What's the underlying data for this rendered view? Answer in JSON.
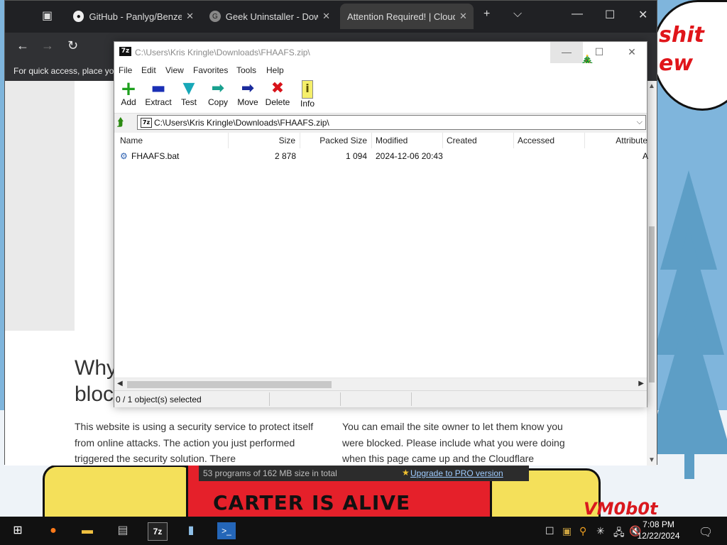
{
  "browser": {
    "tabs": [
      {
        "label": "GitHub - Panlyg/Benzene",
        "close": "✕"
      },
      {
        "label": "Geek Uninstaller - Downl",
        "close": "✕"
      },
      {
        "label": "Attention Required! | Cloudfl",
        "close": "✕"
      }
    ],
    "new_tab": "+",
    "favorites_hint": "For quick access, place you",
    "page": {
      "heading_line1": "Why",
      "heading_line2": "bloc",
      "para_left": "This website is using a security service to protect itself from online attacks. The action you just performed triggered the security solution. There",
      "para_right": "You can email the site owner to let them know you were blocked. Please include what you were doing when this page came up and the Cloudflare"
    }
  },
  "zip": {
    "title": "C:\\Users\\Kris Kringle\\Downloads\\FHAAFS.zip\\",
    "logo": "7z",
    "menu": [
      "File",
      "Edit",
      "View",
      "Favorites",
      "Tools",
      "Help"
    ],
    "toolbar": [
      {
        "label": "Add",
        "icon": "+",
        "color": "#1ea01e"
      },
      {
        "label": "Extract",
        "icon": "▬",
        "color": "#1a2fb5"
      },
      {
        "label": "Test",
        "icon": "▼",
        "color": "#18a8b8"
      },
      {
        "label": "Copy",
        "icon": "➡",
        "color": "#19a08e"
      },
      {
        "label": "Move",
        "icon": "➡",
        "color": "#1a2a9c"
      },
      {
        "label": "Delete",
        "icon": "✖",
        "color": "#d8131a"
      },
      {
        "label": "Info",
        "icon": "i",
        "color": "#5a5000"
      }
    ],
    "path": "C:\\Users\\Kris Kringle\\Downloads\\FHAAFS.zip\\",
    "columns": [
      "Name",
      "Size",
      "Packed Size",
      "Modified",
      "Created",
      "Accessed",
      "Attribute"
    ],
    "rows": [
      {
        "name": "FHAAFS.bat",
        "size": "2 878",
        "packed": "1 094",
        "modified": "2024-12-06 20:43",
        "created": "",
        "accessed": "",
        "attr": "A"
      }
    ],
    "status": "0 / 1 object(s) selected"
  },
  "geek_status": {
    "left": "53 programs of 162 MB size in total",
    "right": "Upgrade to PRO version"
  },
  "wallpaper": {
    "bubble_line1": "shit",
    "bubble_line2": "ew",
    "poster": "CARTER IS ALIVE",
    "signature": "VM0b0t"
  },
  "clock": {
    "time": "7:08 PM",
    "date": "12/22/2024"
  }
}
